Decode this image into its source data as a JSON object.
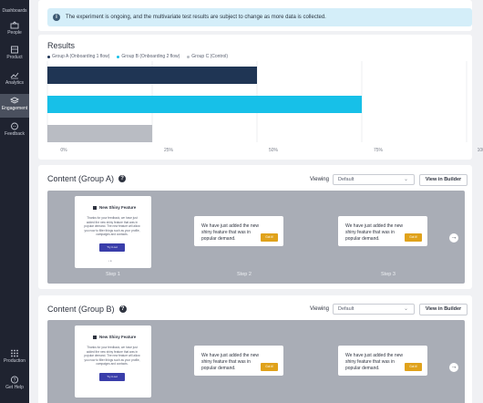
{
  "sidebar": {
    "items": [
      {
        "label": "Dashboards",
        "icon": "dashboard-icon"
      },
      {
        "label": "People",
        "icon": "people-icon"
      },
      {
        "label": "Product",
        "icon": "product-icon"
      },
      {
        "label": "Analytics",
        "icon": "analytics-icon"
      },
      {
        "label": "Engagement",
        "icon": "engagement-icon"
      },
      {
        "label": "Feedback",
        "icon": "feedback-icon"
      },
      {
        "label": "Production",
        "icon": "production-grid-icon"
      },
      {
        "label": "Get Help",
        "icon": "help-icon"
      }
    ]
  },
  "banner": {
    "message": "The experiment is ongoing, and the multivariate test results are subject to change as more data is collected."
  },
  "results": {
    "title": "Results"
  },
  "chart_data": {
    "type": "bar",
    "orientation": "horizontal",
    "categories": [
      "Group A (Onboarding 1 flow)",
      "Group B (Onboarding 2 flow)",
      "Group C (Control)"
    ],
    "series": [
      {
        "name": "Group A (Onboarding 1 flow)",
        "color": "#1f3554",
        "value": 50
      },
      {
        "name": "Group B (Onboarding 2 flow)",
        "color": "#17c0e8",
        "value": 75
      },
      {
        "name": "Group C (Control)",
        "color": "#b9bcc3",
        "value": 25
      }
    ],
    "xlim": [
      0,
      100
    ],
    "x_ticks": [
      "0%",
      "25%",
      "50%",
      "75%",
      "100%"
    ],
    "legend_placement": "top-left",
    "grid": true
  },
  "content_a": {
    "title": "Content (Group A)",
    "viewing_label": "Viewing",
    "select_value": "Default",
    "view_button": "View in Builder"
  },
  "content_b": {
    "title": "Content (Group B)",
    "viewing_label": "Viewing",
    "select_value": "Default",
    "view_button": "View in Builder"
  },
  "preview": {
    "modal_title": "New Shiny Feature",
    "modal_body": "Thanks for your feedback, we have just added the new shiny feature that was in popular demand. The new feature will allow you now to filter things such as your profile, campaigns and contacts.",
    "modal_button": "Try it out",
    "tip_text": "We have just added the new shiny feature that was in popular demand.",
    "tip_button": "Got it!",
    "steps": [
      "Step 1",
      "Step 2",
      "Step 3"
    ],
    "next_arrow": "→"
  },
  "colors": {
    "sidebar_bg": "#1f2330",
    "accent_navy": "#1f3554",
    "accent_cyan": "#17c0e8",
    "control_gray": "#b9bcc3",
    "banner_bg": "#d4eef9",
    "cta_yellow": "#e0a21b",
    "cta_indigo": "#3a3eaa"
  }
}
